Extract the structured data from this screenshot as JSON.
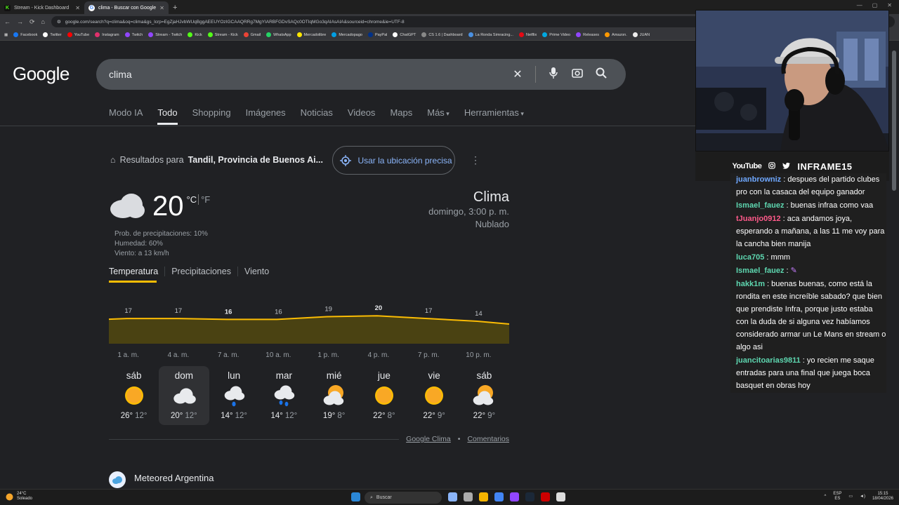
{
  "browser": {
    "tabs": [
      {
        "label": "Stream - Kick Dashboard",
        "active": false,
        "icon": "kick-icon",
        "color": "#53fc18"
      },
      {
        "label": "clima - Buscar con Google",
        "active": true,
        "icon": "google-icon",
        "color": "#4285f4"
      }
    ],
    "url": "google.com/search?q=clima&oq=clima&gs_lcrp=EgZjaHJvbWUqBggAEEUYOzIGCAAQRRg7MgYIARBFGDvSAQc0OTIqMGo3qAIAsAIA&sourceid=chrome&ie=UTF-8",
    "bookmarks": [
      "Facebook",
      "Twitter",
      "YouTube",
      "Instagram",
      "Twitch",
      "Stream - Twitch",
      "Kick",
      "Stream - Kick",
      "Gmail",
      "WhatsApp",
      "Mercadolibre",
      "Mercadopago",
      "PayPal",
      "ChatGPT",
      "CS 1.6 | Dashboard",
      "La Ronda Simracing...",
      "Netflix",
      "Prime Video",
      "Releases",
      "Amazon.",
      "JUAN"
    ]
  },
  "google": {
    "logo": "Google",
    "query": "clima",
    "tabs": [
      "Modo IA",
      "Todo",
      "Shopping",
      "Imágenes",
      "Noticias",
      "Videos",
      "Maps",
      "Más",
      "Herramientas"
    ],
    "results_for_prefix": "Resultados para",
    "results_for_place": "Tandil, Provincia de Buenos Ai...",
    "location_button": "Usar la ubicación precisa"
  },
  "weather": {
    "temp": "20",
    "unit_c": "°C",
    "unit_f": "°F",
    "precip": "Prob. de precipitaciones: 10%",
    "humidity": "Humedad: 60%",
    "wind": "Viento: a 13 km/h",
    "title": "Clima",
    "datetime": "domingo, 3:00 p. m.",
    "condition": "Nublado",
    "tabs": [
      "Temperatura",
      "Precipitaciones",
      "Viento"
    ],
    "days": [
      {
        "name": "sáb",
        "icon": "sun-icon",
        "hi": "26°",
        "lo": "12°"
      },
      {
        "name": "dom",
        "icon": "cloud-icon",
        "hi": "20°",
        "lo": "12°"
      },
      {
        "name": "lun",
        "icon": "rain-icon",
        "hi": "14°",
        "lo": "12°"
      },
      {
        "name": "mar",
        "icon": "heavy-rain-icon",
        "hi": "14°",
        "lo": "12°"
      },
      {
        "name": "mié",
        "icon": "partly-cloudy-icon",
        "hi": "19°",
        "lo": "8°"
      },
      {
        "name": "jue",
        "icon": "sun-icon",
        "hi": "22°",
        "lo": "8°"
      },
      {
        "name": "vie",
        "icon": "sun-icon",
        "hi": "22°",
        "lo": "9°"
      },
      {
        "name": "sáb",
        "icon": "partly-cloudy-icon",
        "hi": "22°",
        "lo": "9°"
      }
    ],
    "footer_links": [
      "Google Clima",
      "Comentarios"
    ],
    "footer_sep": "•",
    "next_result": "Meteored Argentina"
  },
  "chart_data": {
    "type": "area",
    "x": [
      "1 a. m.",
      "4 a. m.",
      "7 a. m.",
      "10 a. m.",
      "1 p. m.",
      "4 p. m.",
      "7 p. m.",
      "10 p. m."
    ],
    "values": [
      17,
      17,
      16,
      16,
      19,
      20,
      17,
      14
    ],
    "bold_labels": [
      2,
      5
    ],
    "color": "#fbbc04",
    "fill": "#4a4212"
  },
  "stream": {
    "platform": "YouTube",
    "handle": "INFRAME15",
    "chat": [
      {
        "user": "juanbrowniz",
        "color": "#6fa8ff",
        "text": "despues del partido clubes pro con la casaca del equipo ganador"
      },
      {
        "user": "Ismael_fauez",
        "color": "#5ed7b0",
        "text": "buenas infraa como vaa"
      },
      {
        "user": "tJuanjo0912",
        "color": "#ff5a8a",
        "text": "aca andamos joya, esperando a mañana, a las 11 me voy para la cancha bien manija"
      },
      {
        "user": "luca705",
        "color": "#5ed7b0",
        "text": "mmm"
      },
      {
        "user": "Ismael_fauez",
        "color": "#5ed7b0",
        "text": ""
      },
      {
        "user": "hakk1m",
        "color": "#5ed7b0",
        "text": "buenas buenas, como está la rondita en este increíble sabado? que bien que prendiste Infra, porque justo estaba con la duda de si alguna vez habíamos considerado armar un Le Mans en stream o algo asi"
      },
      {
        "user": "juancitoarias9811",
        "color": "#5ed7b0",
        "text": "yo recien me saque entradas para una final que juega boca basquet en obras hoy"
      }
    ]
  },
  "taskbar": {
    "weather_temp": "24°C",
    "weather_cond": "Soleado",
    "search": "Buscar",
    "lang1": "ESP",
    "lang2": "ES",
    "time": "15:15",
    "date": "18/04/2026"
  }
}
